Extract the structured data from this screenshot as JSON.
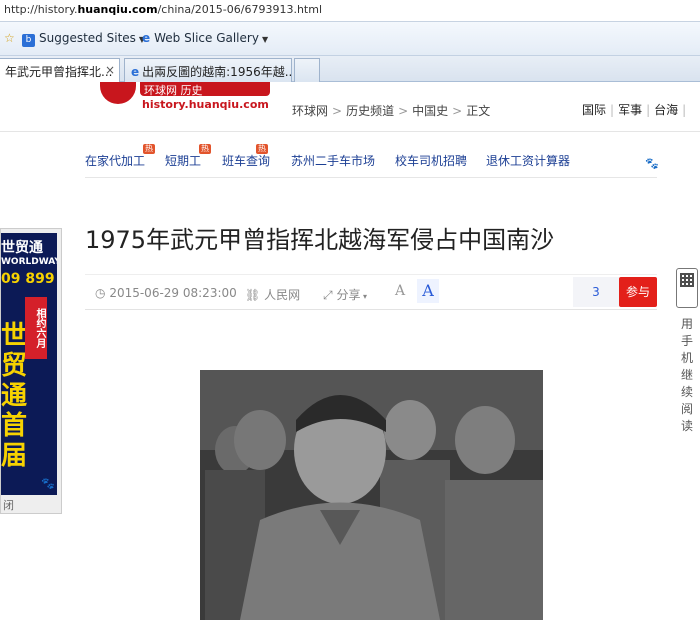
{
  "browser": {
    "url_prefix": "http://history.",
    "url_domain": "huanqiu.com",
    "url_path": "/china/2015-06/6793913.html",
    "favorites": [
      {
        "label": "Suggested Sites"
      },
      {
        "label": "Web Slice Gallery"
      }
    ],
    "tabs": [
      {
        "label": "年武元甲曾指挥北...",
        "close": "×"
      },
      {
        "label": "出兩反圖的越南:1956年越..."
      }
    ]
  },
  "site": {
    "logo_text": "环球网 历史",
    "domain": "history.huanqiu.com",
    "breadcrumb": [
      "环球网",
      "历史频道",
      "中国史",
      "正文"
    ],
    "topnav": [
      "国际",
      "军事",
      "台海"
    ]
  },
  "links": [
    {
      "label": "在家代加工",
      "hot": "热"
    },
    {
      "label": "短期工",
      "hot": "热"
    },
    {
      "label": "班车查询",
      "hot": "热"
    },
    {
      "label": "苏州二手车市场"
    },
    {
      "label": "校车司机招聘"
    },
    {
      "label": "退休工资计算器"
    }
  ],
  "ad": {
    "brand": "世贸通",
    "brand_en": "WORLDWAY",
    "phone": "09 899",
    "big_chars": [
      "世",
      "贸",
      "通",
      "首",
      "届"
    ],
    "badge": "相约六月",
    "close": "闭"
  },
  "article": {
    "title": "1975年武元甲曾指挥北越海军侵占中国南沙",
    "datetime": "2015-06-29 08:23:00",
    "source": "人民网",
    "share": "分享",
    "font_small": "A",
    "font_large": "A",
    "comment_count": "3",
    "join_label": "参与"
  },
  "qr_text": "用手机继续阅读"
}
